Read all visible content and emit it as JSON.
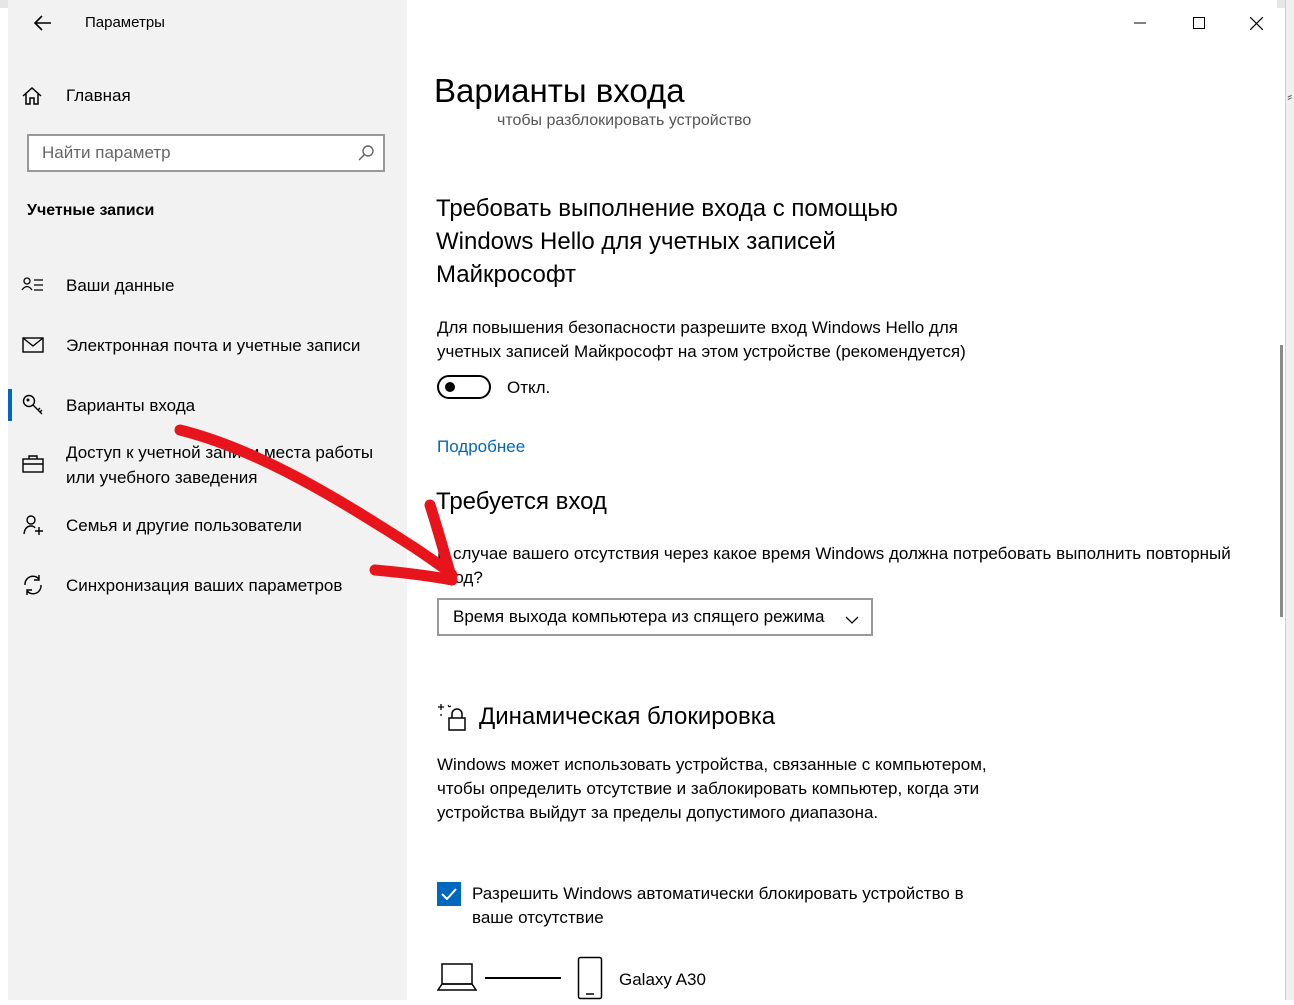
{
  "window": {
    "title": "Параметры"
  },
  "sidebar": {
    "home_label": "Главная",
    "search_placeholder": "Найти параметр",
    "section_title": "Учетные записи",
    "items": [
      {
        "label": "Ваши данные",
        "icon": "person-card-icon"
      },
      {
        "label": "Электронная почта и учетные записи",
        "icon": "mail-icon"
      },
      {
        "label": "Варианты входа",
        "icon": "key-icon",
        "active": true
      },
      {
        "label": "Доступ к учетной записи места работы или учебного заведения",
        "icon": "briefcase-icon"
      },
      {
        "label": "Семья и другие пользователи",
        "icon": "person-add-icon"
      },
      {
        "label": "Синхронизация ваших параметров",
        "icon": "sync-icon"
      }
    ]
  },
  "main": {
    "page_title": "Варианты входа",
    "clipped_text": "чтобы разблокировать устройство",
    "hello": {
      "heading": "Требовать выполнение входа с помощью Windows Hello для учетных записей Майкрософт",
      "description": "Для повышения безопасности разрешите вход Windows Hello для учетных записей Майкрософт на этом устройстве (рекомендуется)",
      "toggle_state": "Откл.",
      "link": "Подробнее"
    },
    "require_signin": {
      "heading": "Требуется вход",
      "description": "В случае вашего отсутствия через какое время Windows должна потребовать выполнить повторный вход?",
      "dropdown_value": "Время выхода компьютера из спящего режима"
    },
    "dynamic_lock": {
      "heading": "Динамическая блокировка",
      "description": "Windows может использовать устройства, связанные с компьютером, чтобы определить отсутствие и заблокировать компьютер, когда эти устройства выйдут за пределы допустимого диапазона.",
      "checkbox_label": "Разрешить Windows автоматически блокировать устройство в ваше отсутствие",
      "checkbox_checked": true,
      "device_name": "Galaxy A30"
    }
  },
  "colors": {
    "accent": "#0067c0",
    "link": "#0067b8",
    "annotation_arrow": "#e8141c"
  }
}
